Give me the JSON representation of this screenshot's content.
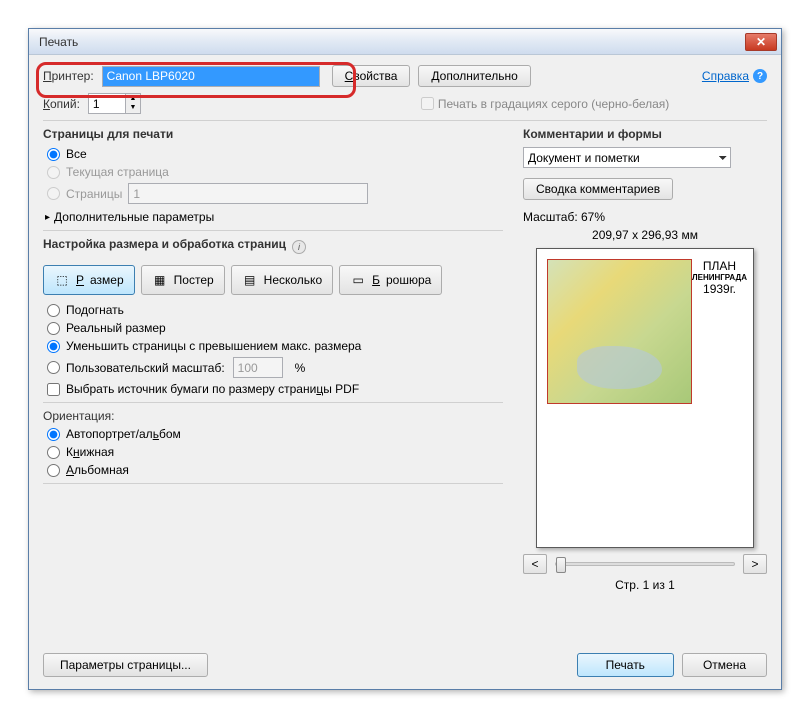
{
  "window": {
    "title": "Печать"
  },
  "top": {
    "printer_label": "Принтер:",
    "printer_value": "Canon LBP6020",
    "properties_btn": "Свойства",
    "advanced_btn": "Дополнительно",
    "help_link": "Справка",
    "copies_label": "Копий:",
    "copies_value": "1",
    "grayscale_label": "Печать в градациях серого (черно-белая)"
  },
  "pages": {
    "section_title": "Страницы для печати",
    "all": "Все",
    "current": "Текущая страница",
    "range": "Страницы",
    "range_value": "1",
    "more": "Дополнительные параметры"
  },
  "sizing": {
    "section_title": "Настройка размера и обработка страниц",
    "size_btn": "Размер",
    "poster_btn": "Постер",
    "multiple_btn": "Несколько",
    "booklet_btn": "Брошюра",
    "fit": "Подогнать",
    "actual": "Реальный размер",
    "shrink": "Уменьшить страницы с превышением макс. размера",
    "custom": "Пользовательский масштаб:",
    "custom_value": "100",
    "percent": "%",
    "paper_source": "Выбрать источник бумаги по размеру страницы PDF"
  },
  "orientation": {
    "label": "Ориентация:",
    "auto": "Автопортрет/альбом",
    "portrait": "Книжная",
    "landscape": "Альбомная"
  },
  "comments": {
    "section_title": "Комментарии и формы",
    "dropdown_value": "Документ и пометки",
    "summary_btn": "Сводка комментариев"
  },
  "preview": {
    "scale_label": "Масштаб:  67%",
    "dimensions": "209,97 x 296,93 мм",
    "map_title_small": "ПЛАН",
    "map_title_big": "ЛЕНИНГРАДА",
    "map_title_year": "1939г.",
    "page_info": "Стр. 1 из 1"
  },
  "bottom": {
    "page_setup": "Параметры страницы...",
    "print": "Печать",
    "cancel": "Отмена"
  }
}
